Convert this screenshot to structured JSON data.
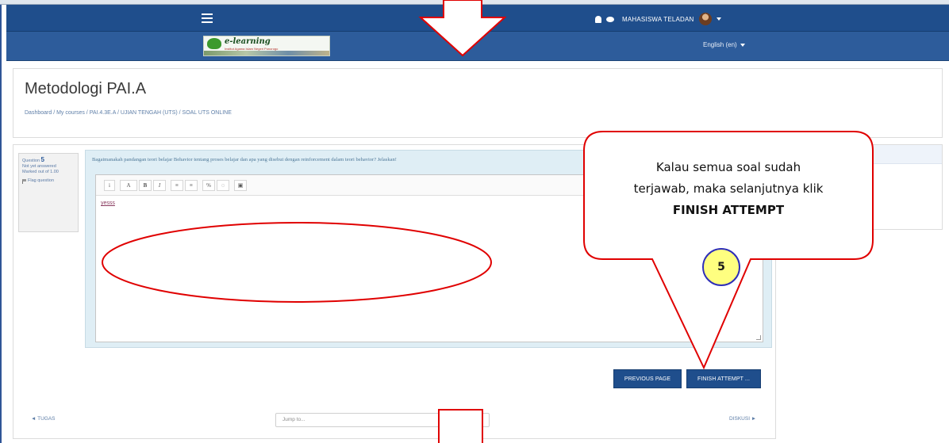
{
  "navbar": {
    "user_name": "MAHASISWA TELADAN",
    "language": "English (en)",
    "logo_title": "e-learning",
    "logo_subtitle": "Institut Agama Islam Negeri Ponorogo"
  },
  "header": {
    "course_title": "Metodologi PAI.A",
    "breadcrumb": "Dashboard / My courses / PAI.4.3E.A / UJIAN TENGAH (UTS) / SOAL UTS ONLINE"
  },
  "question_info": {
    "label": "Question",
    "number": "5",
    "status": "Not yet answered",
    "marked": "Marked out of 1.00",
    "flag": "Flag question"
  },
  "question": {
    "text": "Bagaimanakah pandangan teori belajar Behavior tentang proses belajar dan apa yang disebut dengan reinforcement dalam teori behavior? Jelaskan!",
    "answer": "yesss"
  },
  "toolbar": {
    "items": [
      "i",
      "A",
      "B",
      "I",
      "≡",
      "≡",
      "%",
      "◌",
      "▣"
    ]
  },
  "buttons": {
    "previous": "PREVIOUS PAGE",
    "finish": "FINISH ATTEMPT ..."
  },
  "bottom_nav": {
    "prev_activity": "◄ TUGAS",
    "jump_to": "Jump to...",
    "next_activity": "DISKUSI ►"
  },
  "callout": {
    "line1": "Kalau semua soal sudah",
    "line2": "terjawab, maka selanjutnya klik",
    "line3": "FINISH ATTEMPT",
    "step": "5"
  },
  "colors": {
    "navbar": "#1f4e8c",
    "subbar": "#2d5c9b",
    "annotation_red": "#e00000",
    "badge_fill": "#ffff80",
    "badge_border": "#2e2eb8"
  }
}
